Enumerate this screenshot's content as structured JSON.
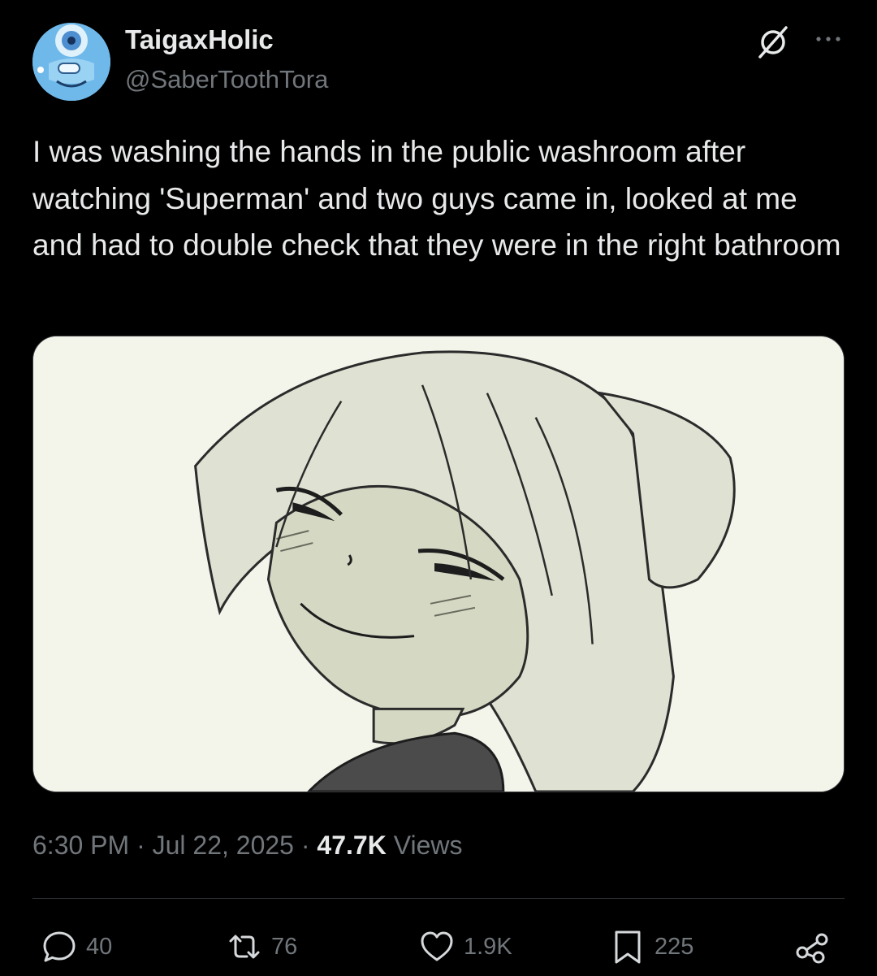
{
  "tweet": {
    "author": {
      "display_name": "TaigaxHolic",
      "handle": "@SaberToothTora"
    },
    "text": "I was washing the hands in the public washroom after watching 'Superman' and two guys came in, looked at me and had to double check that they were in the right bathroom",
    "time": "6:30 PM",
    "date": "Jul 22, 2025",
    "separator": "·",
    "views_count": "47.7K",
    "views_label": "Views"
  },
  "actions": {
    "replies": "40",
    "reposts": "76",
    "likes": "1.9K",
    "bookmarks": "225"
  },
  "icons": {
    "header": [
      "grok-icon",
      "more-icon"
    ],
    "actions": [
      "reply-icon",
      "repost-icon",
      "like-icon",
      "bookmark-icon",
      "share-icon"
    ]
  },
  "colors": {
    "background": "#000000",
    "text_primary": "#e7e9ea",
    "text_secondary": "#71767b",
    "divider": "#2f3336",
    "media_bg": "#f3f4ea"
  }
}
